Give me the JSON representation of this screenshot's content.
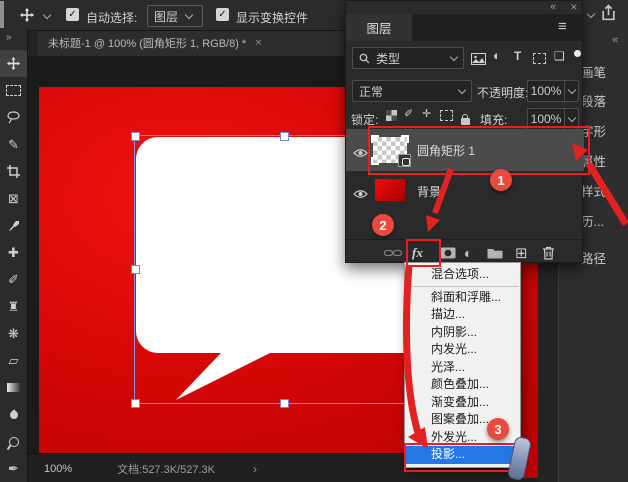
{
  "window": {
    "tab_title": "未标题-1 @ 100% (圆角矩形 1, RGB/8) *",
    "tab_close_glyph": "×",
    "panel_sliver": ""
  },
  "options_bar": {
    "check_glyph": "✓",
    "auto_select_label": "自动选择:",
    "auto_select_value": "图层",
    "show_transform_label": "显示变换控件"
  },
  "toolbar": {
    "expand_glyph": "»",
    "tools": [
      {
        "name": "move-tool",
        "glyph": ""
      },
      {
        "name": "rectangular-marquee-tool",
        "glyph": ""
      },
      {
        "name": "lasso-tool",
        "glyph": ""
      },
      {
        "name": "quick-selection-tool",
        "glyph": "✎"
      },
      {
        "name": "crop-tool",
        "glyph": ""
      },
      {
        "name": "frame-tool",
        "glyph": "⊠"
      },
      {
        "name": "eyedropper-tool",
        "glyph": ""
      },
      {
        "name": "spot-healing-tool",
        "glyph": "✚"
      },
      {
        "name": "brush-tool",
        "glyph": "✐"
      },
      {
        "name": "clone-stamp-tool",
        "glyph": "♜"
      },
      {
        "name": "history-brush-tool",
        "glyph": "❋"
      },
      {
        "name": "eraser-tool",
        "glyph": "▱"
      },
      {
        "name": "gradient-tool",
        "glyph": ""
      },
      {
        "name": "blur-tool",
        "glyph": ""
      },
      {
        "name": "dodge-tool",
        "glyph": ""
      },
      {
        "name": "pen-tool",
        "glyph": "✒"
      }
    ]
  },
  "layers_panel": {
    "collapse_glyph": "«",
    "close_glyph": "✕",
    "menu_glyph": "≡",
    "tab_title": "图层",
    "filter_label": "类型",
    "filter_type_icon": "T",
    "adjustment_icon_glyph": "◐",
    "smart_icon_glyph": "❏",
    "blend_mode": "正常",
    "opacity_label": "不透明度:",
    "opacity_value": "100%",
    "lock_label": "锁定:",
    "lock_brush_glyph": "✐",
    "lock_move_glyph": "✛",
    "fill_label": "填充:",
    "fill_value": "100%",
    "layers": [
      {
        "name": "圆角矩形 1"
      },
      {
        "name": "背景"
      }
    ],
    "fx_button_label": "fx",
    "new_layer_glyph": "⊞"
  },
  "fx_menu": {
    "items": [
      "混合选项...",
      "斜面和浮雕...",
      "描边...",
      "内阴影...",
      "内发光...",
      "光泽...",
      "颜色叠加...",
      "渐变叠加...",
      "图案叠加...",
      "外发光...",
      "投影..."
    ],
    "highlighted_item": "投影..."
  },
  "right_dock": {
    "collapse_glyph": "«",
    "tabs": [
      {
        "label": "画笔",
        "glyph": "✐"
      },
      {
        "label": "段落",
        "glyph": "¶"
      },
      {
        "label": "字形",
        "glyph": "✑"
      },
      {
        "label": "属性",
        "glyph": "≡"
      },
      {
        "label": "样式",
        "glyph": "✦"
      },
      {
        "label": "历...",
        "glyph": "↺"
      },
      {
        "label": "路径",
        "glyph": "❏"
      }
    ]
  },
  "status_bar": {
    "zoom_level": "100%",
    "document_info": "文档:527.3K/527.3K",
    "chevron_glyph": "›"
  },
  "annotations": {
    "step1": "1",
    "step2": "2",
    "step3": "3"
  },
  "colors": {
    "canvas_red": "#d60707",
    "annotation_red": "#ed1c24",
    "badge_red": "#e94a3d",
    "menu_highlight_blue": "#2577e4",
    "selection_blue": "#8194dd"
  }
}
